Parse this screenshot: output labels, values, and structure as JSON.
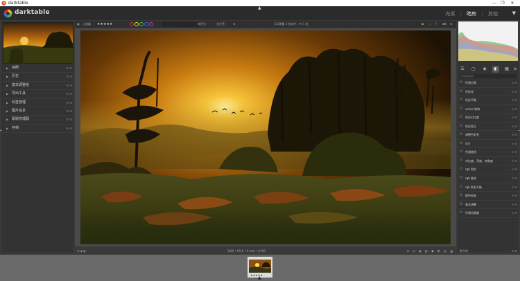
{
  "window": {
    "title": "darktable",
    "minimize": "—",
    "maximize": "❐",
    "close": "✕"
  },
  "brand": {
    "name": "darktable"
  },
  "views": {
    "items": [
      "光桌",
      "暗房",
      "其他"
    ],
    "active": "暗房",
    "separator": "|"
  },
  "left_panel": {
    "modules": [
      "快照",
      "历史",
      "基本调整组",
      "导出工具",
      "标签管理",
      "图片信息",
      "蒙版管理器",
      "存档"
    ]
  },
  "toolbar": {
    "filter_label": "过滤器",
    "rating_filter": "★★★★★",
    "sort_label": "按评分",
    "sort_order": "全升序",
    "image_info": "1/1图像 1 张选中，共 1 张"
  },
  "status": {
    "exif": "1/60 • f/5.6 • 0 mm • 0 ISO",
    "dirty": "脏中的"
  },
  "right_panel": {
    "search_placeholder": "搜索模块名称",
    "modules": [
      "色调分离",
      "色彩化",
      "色彩平衡",
      "velvia 饱和",
      "色彩对比度",
      "色彩校正",
      "调整色彩亮",
      "负片",
      "色调曲线",
      "对比度、亮度、饱和度",
      "rgb 色阶",
      "rgb 曲线",
      "rgb 色彩平衡",
      "颜色校准",
      "基本调整",
      "色调均衡器"
    ]
  },
  "colors": {
    "accent": "#e2e2e2",
    "panel": "#333333",
    "background": "#3a3a3a"
  }
}
